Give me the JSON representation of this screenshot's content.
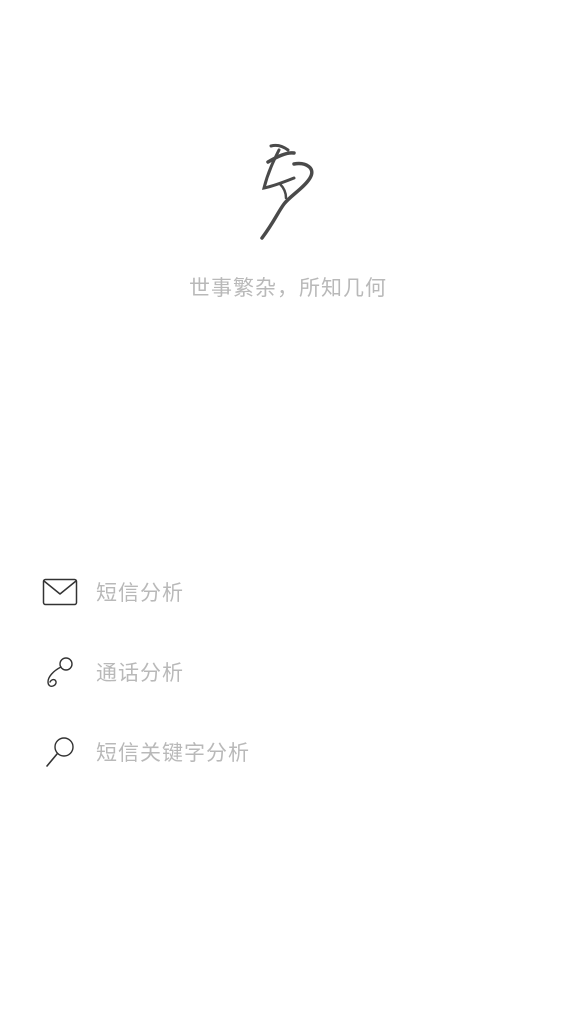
{
  "app": {
    "tagline": "世事繁杂，所知几何"
  },
  "menu": {
    "items": [
      {
        "label": "短信分析",
        "icon": "envelope-icon"
      },
      {
        "label": "通话分析",
        "icon": "phone-handset-icon"
      },
      {
        "label": "短信关键字分析",
        "icon": "search-icon"
      }
    ]
  },
  "colors": {
    "background": "#ffffff",
    "text_muted": "#b9b9b9",
    "icon_stroke": "#333333",
    "logo_stroke": "#4a4a4a"
  }
}
